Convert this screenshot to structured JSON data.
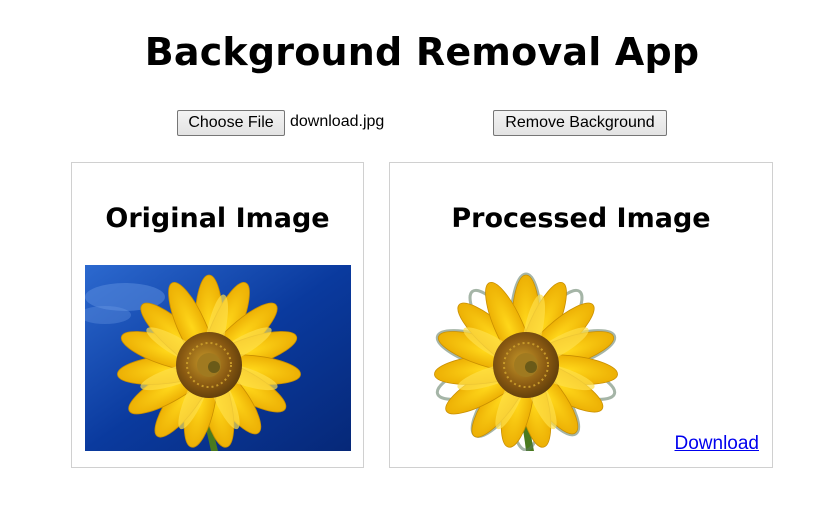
{
  "header": {
    "title": "Background Removal App"
  },
  "file_input": {
    "button_label": "Choose File",
    "selected_file": "download.jpg"
  },
  "actions": {
    "remove_background_label": "Remove Background"
  },
  "original_panel": {
    "title": "Original Image",
    "image_subject": "sunflower-photo"
  },
  "processed_panel": {
    "title": "Processed Image",
    "image_subject": "sunflower-cutout",
    "download_label": "Download"
  },
  "colors": {
    "sky_dark": "#0a2f8c",
    "sky_light": "#2f6fd6",
    "petal": "#f5c400",
    "petal_edge": "#c98f00",
    "center": "#8a5a12",
    "stem": "#4a7a1e",
    "link": "#0000ee"
  }
}
